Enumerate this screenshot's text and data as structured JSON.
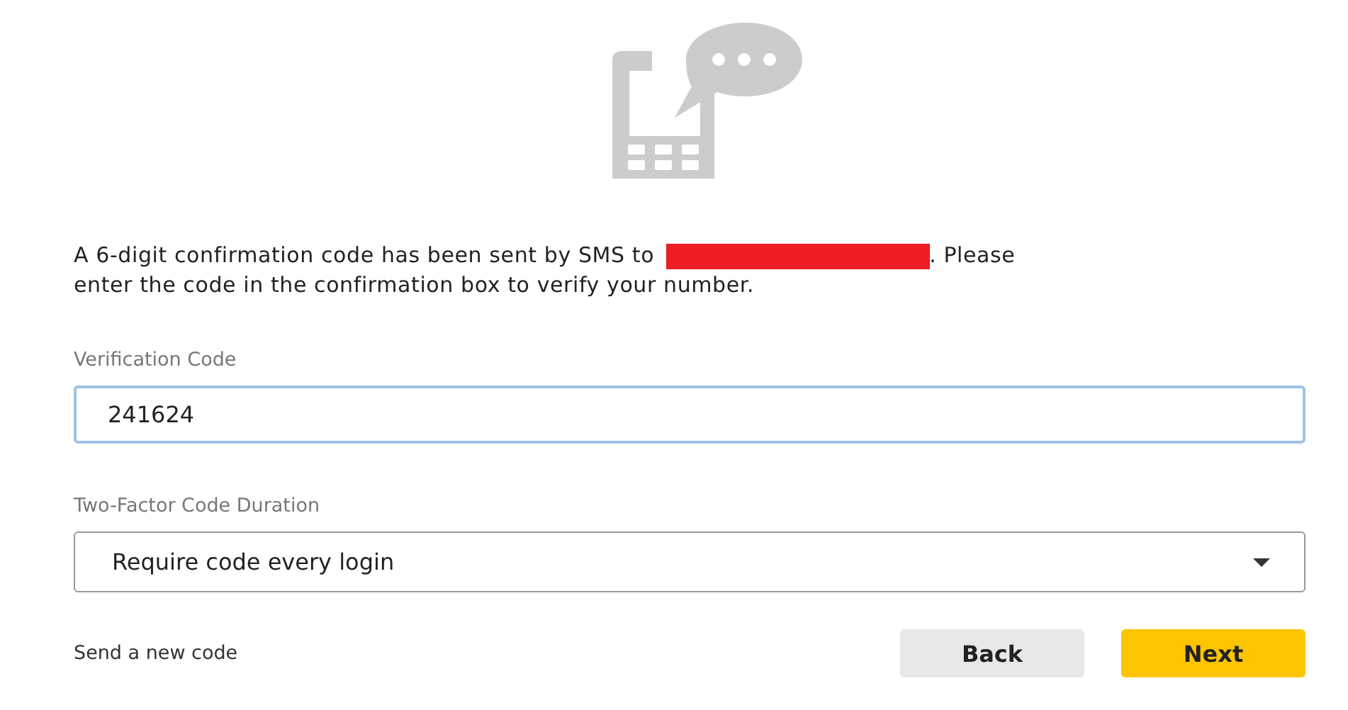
{
  "message": {
    "before": "A 6-digit confirmation code has been sent by SMS to",
    "after": ". Please",
    "second_line": "enter the code in the confirmation box to verify your number."
  },
  "verification": {
    "label": "Verification Code",
    "value": "241624",
    "focused": true
  },
  "duration": {
    "label": "Two-Factor Code Duration",
    "value": "Require code every login"
  },
  "link": "Send a new code",
  "buttons": [
    {
      "label": "Back",
      "kind": "secondary"
    },
    {
      "label": "Next",
      "kind": "primary"
    }
  ]
}
